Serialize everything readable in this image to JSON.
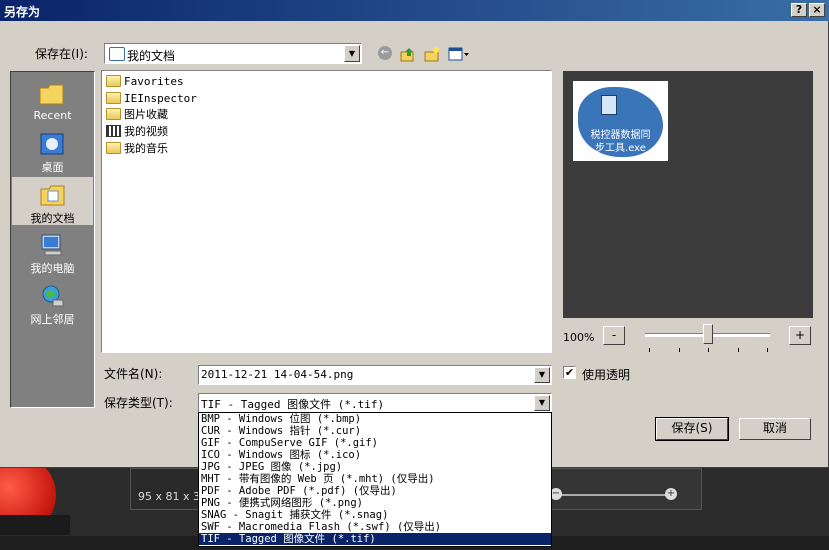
{
  "window": {
    "title": "另存为",
    "help": "?",
    "close": "×"
  },
  "save_in": {
    "label": "保存在(I):",
    "value": "我的文档"
  },
  "places": [
    {
      "label": "Recent"
    },
    {
      "label": "桌面"
    },
    {
      "label": "我的文档"
    },
    {
      "label": "我的电脑"
    },
    {
      "label": "网上邻居"
    }
  ],
  "files": [
    {
      "name": "Favorites",
      "icon": "folder-icon"
    },
    {
      "name": "IEInspector",
      "icon": "folder-icon"
    },
    {
      "name": "图片收藏",
      "icon": "pictures-folder-icon"
    },
    {
      "name": "我的视频",
      "icon": "video-folder-icon"
    },
    {
      "name": "我的音乐",
      "icon": "music-folder-icon"
    }
  ],
  "preview": {
    "caption_line1": "税控器数据同",
    "caption_line2": "步工具.exe"
  },
  "zoom": {
    "label": "100%",
    "minus": "-",
    "plus": "+",
    "level_fraction": 0.5
  },
  "use_transparency": {
    "label": "使用透明",
    "checked": true
  },
  "filename": {
    "label": "文件名(N):",
    "value": "2011-12-21 14-04-54.png"
  },
  "filetype": {
    "label": "保存类型(T):",
    "value": "TIF - Tagged 图像文件 (*.tif)",
    "options": [
      "BMP - Windows 位图 (*.bmp)",
      "CUR - Windows 指针 (*.cur)",
      "GIF - CompuServe GIF (*.gif)",
      "ICO - Windows 图标 (*.ico)",
      "JPG - JPEG 图像 (*.jpg)",
      "MHT - 带有图像的 Web 页 (*.mht) (仅导出)",
      "PDF - Adobe PDF (*.pdf) (仅导出)",
      "PNG - 便携式网络图形 (*.png)",
      "SNAG - Snagit 捕获文件 (*.snag)",
      "SWF - Macromedia Flash (*.swf) (仅导出)",
      "TIF - Tagged 图像文件 (*.tif)"
    ],
    "selected_index": 10
  },
  "buttons": {
    "save": "保存(S)",
    "cancel": "取消"
  },
  "background": {
    "size_text": "95 x 81 x 32"
  }
}
